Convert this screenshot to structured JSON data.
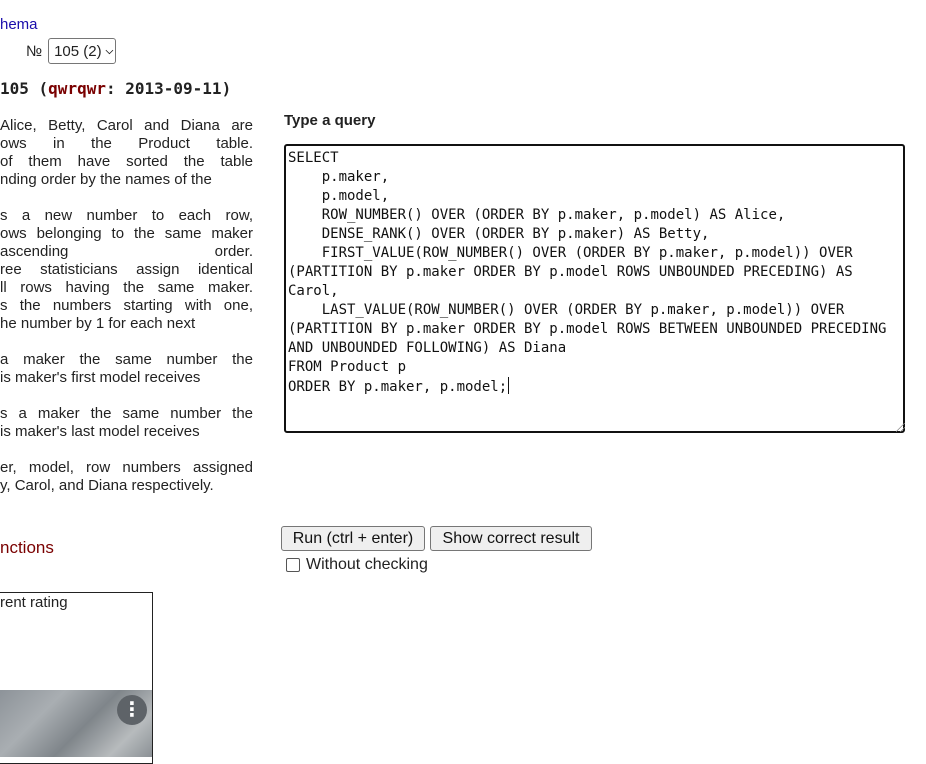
{
  "nav": {
    "schema_link": "hema"
  },
  "task_select": {
    "number_label": "№",
    "selected": "105 (2)"
  },
  "task": {
    "title_prefix": "105 (",
    "author": "qwrqwr",
    "title_suffix": ": 2013-09-11)",
    "description_lines": [
      "Alice, Betty, Carol and Diana are",
      "ows in the Product table.",
      "of them have sorted the table",
      "nding order by the names of the",
      "",
      "s a new number to each row,",
      "ows belonging to the same maker",
      "ascending order.",
      "ree statisticians assign identical",
      "ll rows having the same maker.",
      "s the numbers starting with one,",
      "he number by 1 for each next",
      "",
      "a maker the same number the",
      "is maker's first model receives",
      "",
      "s a maker the same number the",
      "is maker's last model receives",
      "",
      "er, model, row numbers assigned",
      "y, Carol, and Diana respectively."
    ]
  },
  "sidebar": {
    "functions_link": "nctions",
    "rating_label": "rent rating"
  },
  "query": {
    "label": "Type a query",
    "text": "SELECT\n    p.maker,\n    p.model,\n    ROW_NUMBER() OVER (ORDER BY p.maker, p.model) AS Alice,\n    DENSE_RANK() OVER (ORDER BY p.maker) AS Betty,\n    FIRST_VALUE(ROW_NUMBER() OVER (ORDER BY p.maker, p.model)) OVER (PARTITION BY p.maker ORDER BY p.model ROWS UNBOUNDED PRECEDING) AS Carol,\n    LAST_VALUE(ROW_NUMBER() OVER (ORDER BY p.maker, p.model)) OVER (PARTITION BY p.maker ORDER BY p.model ROWS BETWEEN UNBOUNDED PRECEDING AND UNBOUNDED FOLLOWING) AS Diana\nFROM Product p\nORDER BY p.maker, p.model;"
  },
  "actions": {
    "run_label": "Run (ctrl + enter)",
    "show_result_label": "Show correct result",
    "without_checking_label": "Without checking",
    "without_checking_checked": false
  },
  "icons": {
    "select_chevron": "chevron-down-icon",
    "more": "kebab-menu-icon"
  },
  "colors": {
    "link": "#1a0dab",
    "author": "#7a0000",
    "functions_link": "#7a0000"
  }
}
